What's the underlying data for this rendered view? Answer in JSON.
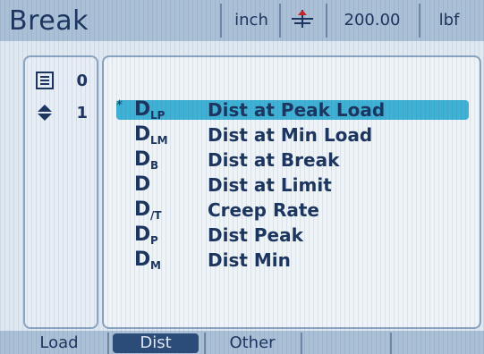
{
  "header": {
    "title": "Break",
    "units": "inch",
    "value": "200.00",
    "force_unit": "lbf",
    "icon": "tare-icon"
  },
  "left_panel": {
    "rows": [
      {
        "icon": "list-icon",
        "value": "0"
      },
      {
        "icon": "up-down-arrow-icon",
        "value": "1"
      }
    ]
  },
  "list": {
    "selected_marker": "*",
    "items": [
      {
        "symbol": "D",
        "subscript": "LP",
        "label": "Dist at Peak Load"
      },
      {
        "symbol": "D",
        "subscript": "LM",
        "label": "Dist at Min Load"
      },
      {
        "symbol": "D",
        "subscript": "B",
        "label": "Dist at Break"
      },
      {
        "symbol": "D",
        "subscript": "",
        "label": "Dist at Limit"
      },
      {
        "symbol": "D",
        "subscript": "/T",
        "label": "Creep Rate"
      },
      {
        "symbol": "D",
        "subscript": "P",
        "label": "Dist Peak"
      },
      {
        "symbol": "D",
        "subscript": "M",
        "label": "Dist Min"
      }
    ]
  },
  "tabs": [
    "Load",
    "Dist",
    "Other",
    "",
    ""
  ],
  "colors": {
    "background": "#dfe8f1",
    "header": "#aac0d6",
    "text": "#1c3560",
    "highlight": "#3fb1d4",
    "active_tab": "#2b4b79"
  }
}
